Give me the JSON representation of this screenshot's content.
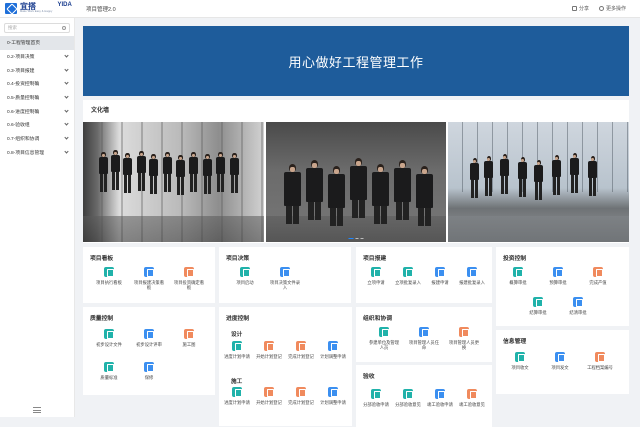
{
  "header": {
    "logo_cn": "宜搭",
    "logo_en": "Make Work Easy & Happy",
    "logo_brand": "YIDA",
    "app_title": "项目管理2.0",
    "share_label": "分享",
    "more_label": "更多操作"
  },
  "sidebar": {
    "search_placeholder": "搜索",
    "items": [
      {
        "label": "0-工程管理首页",
        "active": true
      },
      {
        "label": "0.2-项目决策"
      },
      {
        "label": "0.3-项目报建"
      },
      {
        "label": "0.4-投资控制确"
      },
      {
        "label": "0.5-质量控制确"
      },
      {
        "label": "0.6-进度控制确"
      },
      {
        "label": "0.6-验收组"
      },
      {
        "label": "0.7-组织和协调"
      },
      {
        "label": "0.8-项目信息管理"
      }
    ]
  },
  "banner": {
    "title": "用心做好工程管理工作"
  },
  "culture": {
    "title": "文化墙"
  },
  "cards": {
    "dashboard": {
      "title": "项目看板",
      "items": [
        {
          "label": "项目执行看板",
          "icon": "doc-icon",
          "color": "teal"
        },
        {
          "label": "项目报建决策看板",
          "icon": "doc-icon",
          "color": "blue"
        },
        {
          "label": "项目投资确定看板",
          "icon": "doc-icon",
          "color": "orange"
        }
      ]
    },
    "decision": {
      "title": "项目决策",
      "items": [
        {
          "label": "项目启动",
          "icon": "doc-icon",
          "color": "teal"
        },
        {
          "label": "项目决策文件录入",
          "icon": "doc-icon",
          "color": "blue"
        }
      ]
    },
    "approval": {
      "title": "项目报建",
      "items": [
        {
          "label": "立项申请",
          "icon": "doc-icon",
          "color": "teal"
        },
        {
          "label": "立项批复录入",
          "icon": "doc-icon",
          "color": "teal"
        },
        {
          "label": "报建申请",
          "icon": "doc-icon",
          "color": "blue"
        },
        {
          "label": "报建批复录入",
          "icon": "doc-icon",
          "color": "blue"
        }
      ]
    },
    "investment": {
      "title": "投资控制",
      "items": [
        {
          "label": "概算审批",
          "icon": "doc-icon",
          "color": "teal"
        },
        {
          "label": "预算审批",
          "icon": "doc-icon",
          "color": "blue"
        },
        {
          "label": "完成产值",
          "icon": "doc-icon",
          "color": "orange"
        },
        {
          "label": "结算审批",
          "icon": "doc-icon",
          "color": "teal"
        },
        {
          "label": "结清审批",
          "icon": "doc-icon",
          "color": "blue"
        }
      ]
    },
    "quality": {
      "title": "质量控制",
      "items": [
        {
          "label": "初步设计文件",
          "icon": "doc-icon",
          "color": "teal"
        },
        {
          "label": "初步设计评审",
          "icon": "doc-icon",
          "color": "blue"
        },
        {
          "label": "施工图",
          "icon": "doc-icon",
          "color": "orange"
        },
        {
          "label": "质量标准",
          "icon": "doc-icon",
          "color": "teal"
        },
        {
          "label": "保修",
          "icon": "doc-icon",
          "color": "blue"
        }
      ]
    },
    "schedule": {
      "title": "进度控制",
      "design_title": "设计",
      "construction_title": "施工",
      "design_items": [
        {
          "label": "进度计划申请",
          "icon": "doc-icon",
          "color": "teal"
        },
        {
          "label": "开始计划登记",
          "icon": "doc-icon",
          "color": "orange"
        },
        {
          "label": "完成计划登记",
          "icon": "doc-icon",
          "color": "orange"
        },
        {
          "label": "计划调整申请",
          "icon": "doc-icon",
          "color": "blue"
        }
      ],
      "construction_items": [
        {
          "label": "进度计划申请",
          "icon": "doc-icon",
          "color": "teal"
        },
        {
          "label": "开始计划登记",
          "icon": "doc-icon",
          "color": "orange"
        },
        {
          "label": "完成计划登记",
          "icon": "doc-icon",
          "color": "orange"
        },
        {
          "label": "计划调整申请",
          "icon": "doc-icon",
          "color": "blue"
        }
      ]
    },
    "organization": {
      "title": "组织和协调",
      "items": [
        {
          "label": "参建单位及管理人员",
          "icon": "doc-icon",
          "color": "teal"
        },
        {
          "label": "项目管理人员任命",
          "icon": "doc-icon",
          "color": "blue"
        },
        {
          "label": "项目管理人员更换",
          "icon": "doc-icon",
          "color": "orange"
        }
      ]
    },
    "acceptance": {
      "title": "验收",
      "items": [
        {
          "label": "分部验收申请",
          "icon": "doc-icon",
          "color": "teal"
        },
        {
          "label": "分部验收意见",
          "icon": "doc-icon",
          "color": "teal"
        },
        {
          "label": "竣工验收申请",
          "icon": "doc-icon",
          "color": "blue"
        },
        {
          "label": "竣工验收意见",
          "icon": "doc-icon",
          "color": "orange"
        }
      ]
    },
    "information": {
      "title": "信息管理",
      "items": [
        {
          "label": "项目收文",
          "icon": "doc-icon",
          "color": "teal"
        },
        {
          "label": "项目发文",
          "icon": "doc-icon",
          "color": "blue"
        },
        {
          "label": "工程档案编号",
          "icon": "doc-icon",
          "color": "orange"
        }
      ]
    }
  },
  "colors": {
    "banner": "#1e5c9b",
    "teal": "#20b2aa",
    "blue": "#3b8ff0",
    "orange": "#f08a5d"
  }
}
